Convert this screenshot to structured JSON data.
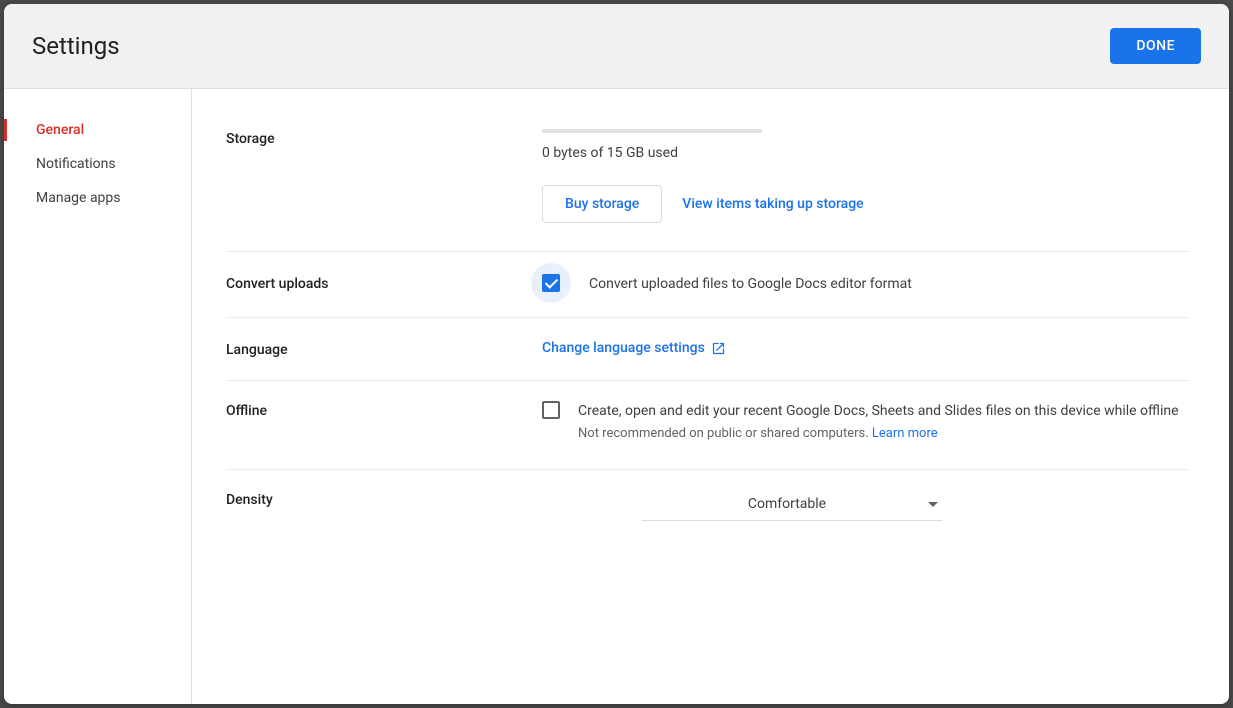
{
  "header": {
    "title": "Settings",
    "done": "DONE"
  },
  "sidebar": {
    "items": [
      {
        "label": "General",
        "active": true
      },
      {
        "label": "Notifications",
        "active": false
      },
      {
        "label": "Manage apps",
        "active": false
      }
    ]
  },
  "sections": {
    "storage": {
      "label": "Storage",
      "used_text": "0 bytes of 15 GB used",
      "buy_label": "Buy storage",
      "view_items_label": "View items taking up storage"
    },
    "convert": {
      "label": "Convert uploads",
      "checkbox_text": "Convert uploaded files to Google Docs editor format",
      "checked": true
    },
    "language": {
      "label": "Language",
      "link_label": "Change language settings"
    },
    "offline": {
      "label": "Offline",
      "checkbox_text": "Create, open and edit your recent Google Docs, Sheets and Slides files on this device while offline",
      "hint_text": "Not recommended on public or shared computers. ",
      "learn_more": "Learn more",
      "checked": false
    },
    "density": {
      "label": "Density",
      "value": "Comfortable"
    }
  }
}
